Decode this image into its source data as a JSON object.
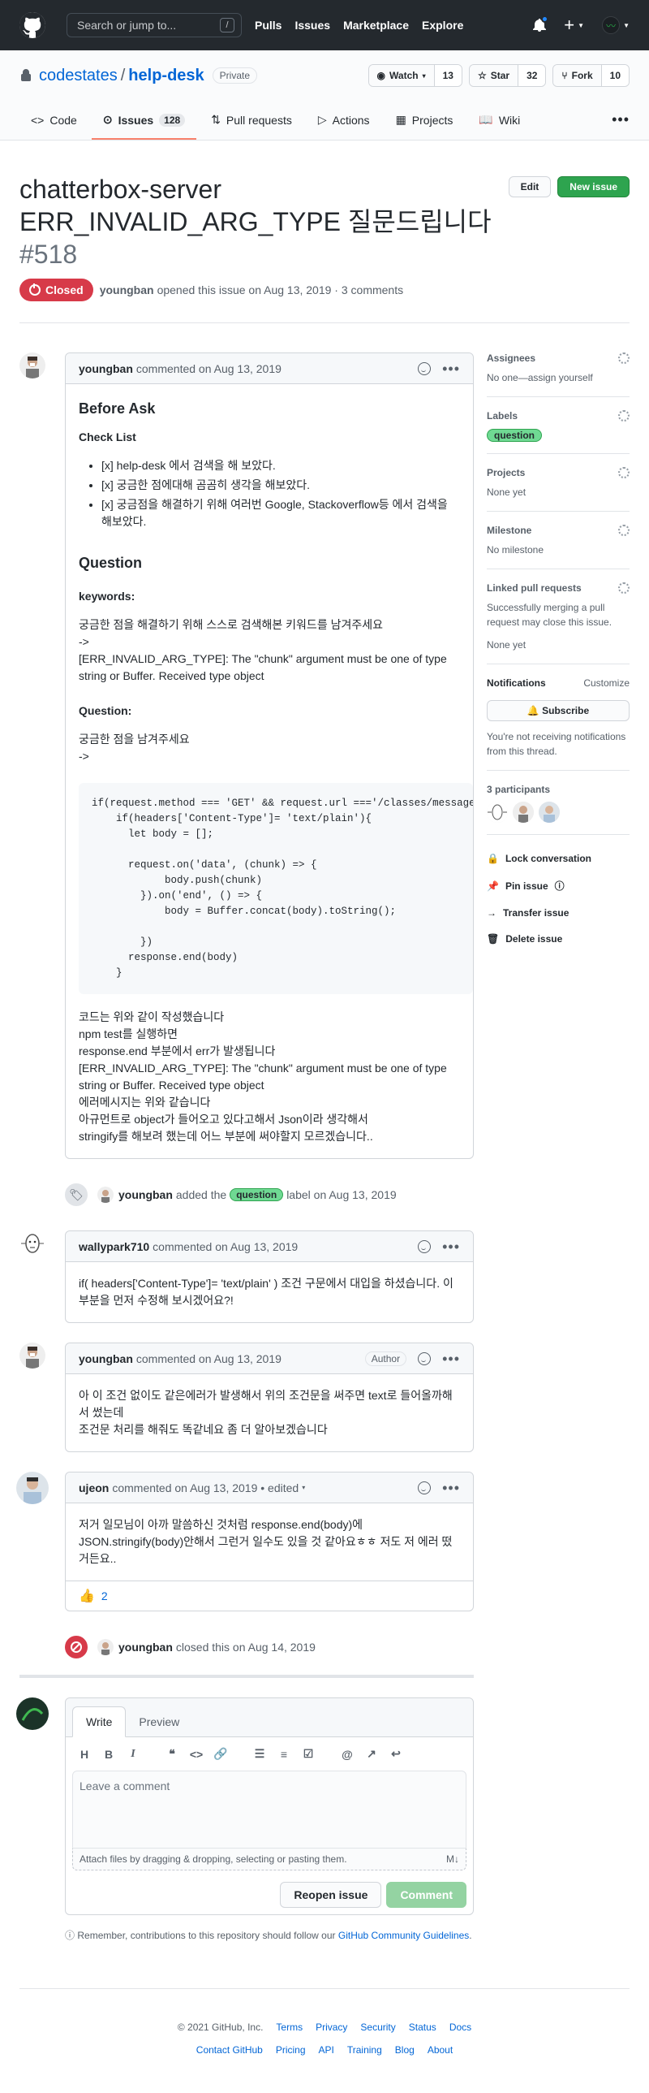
{
  "header": {
    "search_placeholder": "Search or jump to...",
    "slash": "/",
    "nav": [
      "Pulls",
      "Issues",
      "Marketplace",
      "Explore"
    ]
  },
  "repo": {
    "owner": "codestates",
    "name": "help-desk",
    "visibility": "Private",
    "watch": {
      "label": "Watch",
      "count": "13"
    },
    "star": {
      "label": "Star",
      "count": "32"
    },
    "fork": {
      "label": "Fork",
      "count": "10"
    },
    "tabs": [
      {
        "label": "Code"
      },
      {
        "label": "Issues",
        "count": "128"
      },
      {
        "label": "Pull requests"
      },
      {
        "label": "Actions"
      },
      {
        "label": "Projects"
      },
      {
        "label": "Wiki"
      }
    ]
  },
  "issue": {
    "title_line1": "chatterbox-server",
    "title_line2": "ERR_INVALID_ARG_TYPE 질문드립니다",
    "number": "#518",
    "edit": "Edit",
    "new_issue": "New issue",
    "state": "Closed",
    "author": "youngban",
    "opened": "opened this issue on Aug 13, 2019 · 3 comments"
  },
  "comments": {
    "c1": {
      "author": "youngban",
      "when": "commented on Aug 13, 2019",
      "h_before": "Before Ask",
      "h_check": "Check List",
      "checklist": [
        "[x] help-desk 에서 검색을 해 보았다.",
        "[x] 궁금한 점에대해 곰곰히 생각을 해보았다.",
        "[x] 궁금점을 해결하기 위해 여러번 Google, Stackoverflow등 에서 검색을 해보았다."
      ],
      "h_question": "Question",
      "h_keywords": "keywords:",
      "kw1": "궁금한 점을 해결하기 위해 스스로 검색해본 키워드를 남겨주세요",
      "kw2": "->",
      "kw3": "[ERR_INVALID_ARG_TYPE]: The \"chunk\" argument must be one of type string or Buffer. Received type object",
      "h_q2": "Question:",
      "q1": "궁금한 점을 남겨주세요",
      "q2": "->",
      "code": "if(request.method === 'GET' && request.url ==='/classes/messages'){\n    if(headers['Content-Type']= 'text/plain'){\n      let body = [];\n\n      request.on('data', (chunk) => {\n            body.push(chunk)\n        }).on('end', () => {\n            body = Buffer.concat(body).toString();\n\n        })\n      response.end(body)\n    }",
      "tail": [
        "코드는 위와 같이 작성했습니다",
        "npm test를 실행하면",
        "response.end 부분에서 err가 발생됩니다",
        "[ERR_INVALID_ARG_TYPE]: The \"chunk\" argument must be one of type string or Buffer. Received type object",
        "에러메시지는 위와 같습니다",
        "아규먼트로 object가 들어오고 있다고해서 Json이라 생각해서",
        "stringify를 해보려 했는데 어느 부분에 써야할지 모르겠습니다.."
      ]
    },
    "ev_label": {
      "who": "youngban",
      "pre": "added the",
      "label": "question",
      "post": "label on Aug 13, 2019"
    },
    "c2": {
      "author": "wallypark710",
      "when": "commented on Aug 13, 2019",
      "body": "if( headers['Content-Type']= 'text/plain' ) 조건 구문에서 대입을 하셨습니다. 이부분을 먼저 수정해 보시겠어요?!"
    },
    "c3": {
      "author": "youngban",
      "when": "commented on Aug 13, 2019",
      "badge": "Author",
      "body1": "아 이 조건 없이도 같은에러가 발생해서 위의 조건문을 써주면 text로 들어올까해서 썼는데",
      "body2": "조건문 처리를 해줘도 똑같네요 좀 더 알아보겠습니다"
    },
    "c4": {
      "author": "ujeon",
      "when": "commented on Aug 13, 2019 • edited",
      "body": "저거 일모님이 아까 말씀하신 것처럼 response.end(body)에 JSON.stringify(body)안해서 그런거 일수도 있을 것 같아요ㅎㅎ 저도 저 에러 떴거든요..",
      "reaction_count": "2"
    },
    "ev_closed": {
      "who": "youngban",
      "text": "closed this on Aug 14, 2019"
    }
  },
  "sidebar": {
    "assignees": {
      "title": "Assignees",
      "value": "No one—assign yourself"
    },
    "labels": {
      "title": "Labels",
      "value": "question"
    },
    "projects": {
      "title": "Projects",
      "value": "None yet"
    },
    "milestone": {
      "title": "Milestone",
      "value": "No milestone"
    },
    "linked": {
      "title": "Linked pull requests",
      "desc": "Successfully merging a pull request may close this issue.",
      "value": "None yet"
    },
    "notifications": {
      "title": "Notifications",
      "customize": "Customize",
      "subscribe": "Subscribe",
      "desc": "You're not receiving notifications from this thread."
    },
    "participants": {
      "title": "3 participants"
    },
    "actions": [
      "Lock conversation",
      "Pin issue",
      "Transfer issue",
      "Delete issue"
    ]
  },
  "new_comment": {
    "write": "Write",
    "preview": "Preview",
    "placeholder": "Leave a comment",
    "attach": "Attach files by dragging & dropping, selecting or pasting them.",
    "reopen": "Reopen issue",
    "comment": "Comment",
    "remember_pre": "Remember, contributions to this repository should follow our",
    "remember_link": "GitHub Community Guidelines",
    "remember_post": "."
  },
  "footer": {
    "row1": [
      "© 2021 GitHub, Inc.",
      "Terms",
      "Privacy",
      "Security",
      "Status",
      "Docs"
    ],
    "row2": [
      "Contact GitHub",
      "Pricing",
      "API",
      "Training",
      "Blog",
      "About"
    ]
  },
  "colors": {
    "closed": "#d73a49",
    "label": "#6fd993",
    "accent": "#f9826c",
    "link": "#0366d6"
  }
}
